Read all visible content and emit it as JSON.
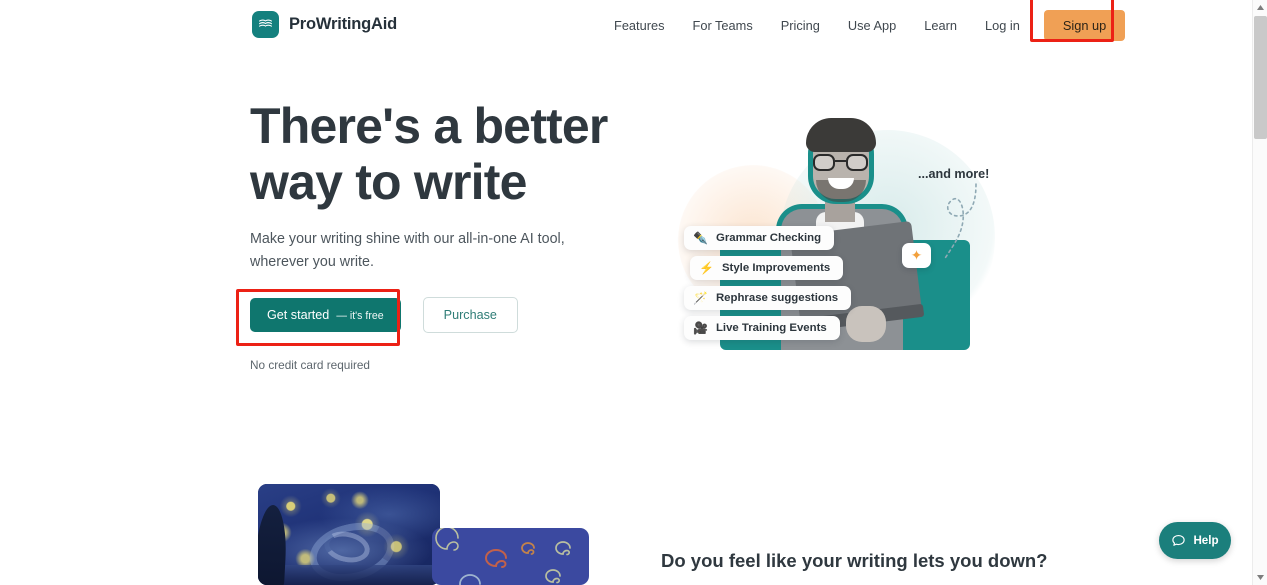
{
  "brand": {
    "name": "ProWritingAid",
    "logo_icon": "open-book-icon",
    "logo_color": "#14807e"
  },
  "nav": {
    "links": [
      {
        "label": "Features"
      },
      {
        "label": "For Teams"
      },
      {
        "label": "Pricing"
      },
      {
        "label": "Use App"
      },
      {
        "label": "Learn"
      },
      {
        "label": "Log in"
      }
    ],
    "signup": {
      "label": "Sign up",
      "background": "#f0a055",
      "highlighted": true,
      "highlight_color": "#ec2115"
    }
  },
  "hero": {
    "title": "There's a better way to write",
    "subtitle": "Make your writing shine with our all-in-one AI tool, wherever you write.",
    "primary_cta": {
      "label": "Get started",
      "suffix": "— it's free",
      "background": "#0f766e",
      "highlighted": true,
      "highlight_color": "#ec2115"
    },
    "secondary_cta": {
      "label": "Purchase",
      "text_color": "#2f7d77"
    },
    "note": "No credit card required"
  },
  "illustration": {
    "annotation": "...and more!",
    "sparkle_icon": "sparkle-icon",
    "features": [
      {
        "icon": "pen-icon",
        "emoji": "✒️",
        "label": "Grammar Checking"
      },
      {
        "icon": "lightning-icon",
        "emoji": "⚡",
        "label": "Style Improvements"
      },
      {
        "icon": "magic-wand-icon",
        "emoji": "🪄",
        "label": "Rephrase suggestions"
      },
      {
        "icon": "video-camera-icon",
        "emoji": "🎥",
        "label": "Live Training Events"
      }
    ]
  },
  "bottom": {
    "heading": "Do you feel like your writing lets you down?",
    "artwork_primary": "starry-night-painting",
    "artwork_secondary": "blue-doodle-card"
  },
  "help_widget": {
    "label": "Help",
    "icon": "chat-bubble-icon",
    "background": "#1b7f7c"
  },
  "scrollbar": {
    "up_arrow": "▲",
    "down_arrow": "▼"
  }
}
